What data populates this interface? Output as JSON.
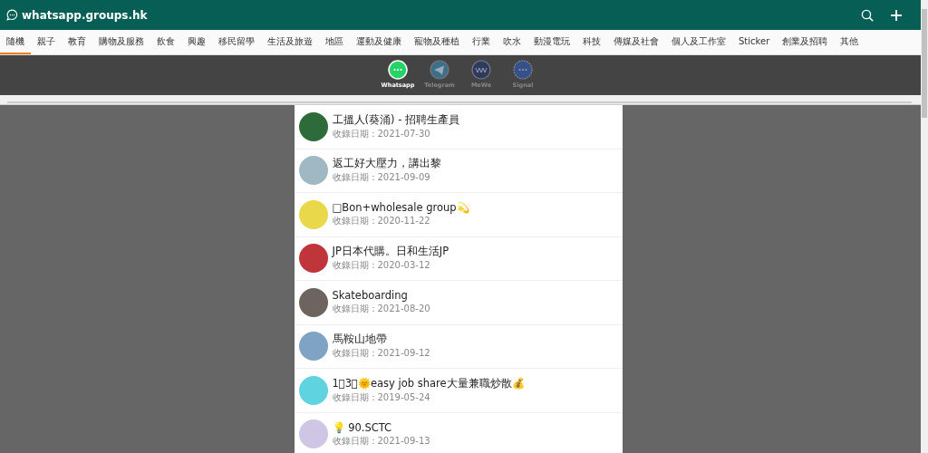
{
  "header": {
    "site_title": "whatsapp.groups.hk"
  },
  "categories": [
    {
      "label": "隨機",
      "selected": true
    },
    {
      "label": "親子",
      "selected": false
    },
    {
      "label": "教育",
      "selected": false
    },
    {
      "label": "購物及服務",
      "selected": false
    },
    {
      "label": "飲食",
      "selected": false
    },
    {
      "label": "興趣",
      "selected": false
    },
    {
      "label": "移民留學",
      "selected": false
    },
    {
      "label": "生活及旅遊",
      "selected": false
    },
    {
      "label": "地區",
      "selected": false
    },
    {
      "label": "運動及健康",
      "selected": false
    },
    {
      "label": "寵物及種植",
      "selected": false
    },
    {
      "label": "行業",
      "selected": false
    },
    {
      "label": "吹水",
      "selected": false
    },
    {
      "label": "動漫電玩",
      "selected": false
    },
    {
      "label": "科技",
      "selected": false
    },
    {
      "label": "傳媒及社會",
      "selected": false
    },
    {
      "label": "個人及工作室",
      "selected": false
    },
    {
      "label": "Sticker",
      "selected": false
    },
    {
      "label": "創業及招聘",
      "selected": false
    },
    {
      "label": "其他",
      "selected": false
    }
  ],
  "platforms": [
    {
      "label": "Whatsapp",
      "kind": "whatsapp",
      "selected": true
    },
    {
      "label": "Telegram",
      "kind": "telegram",
      "selected": false
    },
    {
      "label": "MeWe",
      "kind": "mewe",
      "selected": false
    },
    {
      "label": "Signal",
      "kind": "signal",
      "selected": false
    }
  ],
  "groups": [
    {
      "title": "工搵人(葵涌) - 招聘生產員",
      "date": "收錄日期：2021-07-30",
      "color": "#2e6b3a"
    },
    {
      "title": "返工好大壓力，講出黎",
      "date": "收錄日期：2021-09-09",
      "color": "#9fb8c4"
    },
    {
      "title": "□Bon+wholesale group💫",
      "date": "收錄日期：2020-11-22",
      "color": "#e8d84a"
    },
    {
      "title": "JP日本代購。日和生活JP",
      "date": "收錄日期：2020-03-12",
      "color": "#c0353a"
    },
    {
      "title": "Skateboarding",
      "date": "收錄日期：2021-08-20",
      "color": "#6d6460"
    },
    {
      "title": "馬鞍山地帶",
      "date": "收錄日期：2021-09-12",
      "color": "#7fa3c4"
    },
    {
      "title": "1⃣3⃣🌞easy job share大量兼職炒散💰",
      "date": "收錄日期：2019-05-24",
      "color": "#5fd3e0"
    },
    {
      "title": "💡 90.SCTC",
      "date": "收錄日期：2021-09-13",
      "color": "#cfc6e6"
    }
  ]
}
